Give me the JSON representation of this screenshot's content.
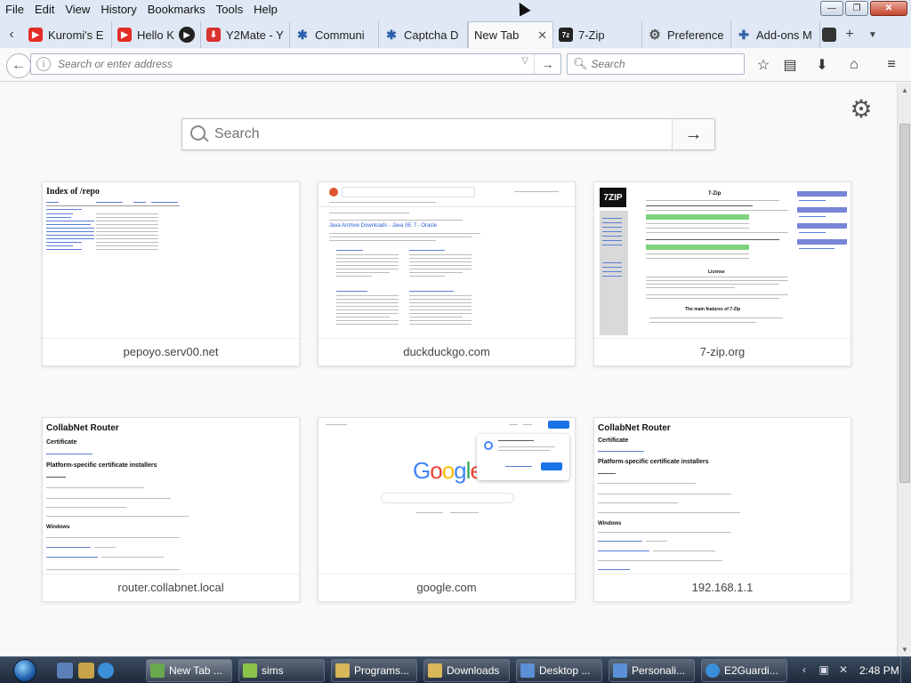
{
  "menu": [
    "File",
    "Edit",
    "View",
    "History",
    "Bookmarks",
    "Tools",
    "Help"
  ],
  "window_controls": {
    "minimize": "—",
    "restore": "❐",
    "close": "✕"
  },
  "tabs": [
    {
      "label": "Kuromi's E",
      "icon": "youtube-icon"
    },
    {
      "label": "Hello K",
      "icon": "youtube-icon"
    },
    {
      "label": "Y2Mate - Y",
      "icon": "y2mate-icon"
    },
    {
      "label": "Communi",
      "icon": "github-icon"
    },
    {
      "label": "Captcha D",
      "icon": "github-icon"
    },
    {
      "label": "New Tab",
      "icon": "",
      "active": true
    },
    {
      "label": "7-Zip",
      "icon": "7zip-icon"
    },
    {
      "label": "Preference",
      "icon": "gear-icon"
    },
    {
      "label": "Add-ons M",
      "icon": "puzzle-icon"
    }
  ],
  "nav": {
    "url_placeholder": "Search or enter address",
    "search_placeholder": "Search"
  },
  "page": {
    "search_placeholder": "Search",
    "tiles": [
      {
        "title": "pepoyo.serv00.net",
        "thumb_heading": "Index of /repo"
      },
      {
        "title": "duckduckgo.com",
        "thumb_heading": "Java Archive Downloads - Java SE 7 - Oracle"
      },
      {
        "title": "7-zip.org",
        "thumb_heading": "7-Zip"
      },
      {
        "title": "router.collabnet.local",
        "thumb_heading": "CollabNet Router"
      },
      {
        "title": "google.com",
        "thumb_heading": "Google"
      },
      {
        "title": "192.168.1.1",
        "thumb_heading": "CollabNet Router"
      }
    ],
    "collab_thumb": {
      "certificate": "Certificate",
      "installers": "Platform-specific certificate installers",
      "windows": "Windows"
    },
    "sevenzip_thumb": {
      "logo": "7ZIP",
      "heading": "7-Zip",
      "section": "License",
      "features": "The main features of 7-Zip"
    }
  },
  "taskbar": {
    "buttons": [
      {
        "label": "New Tab ..."
      },
      {
        "label": "sims"
      },
      {
        "label": "Programs..."
      },
      {
        "label": "Downloads"
      },
      {
        "label": "Desktop ..."
      },
      {
        "label": "Personali..."
      },
      {
        "label": "E2Guardi..."
      }
    ],
    "time": "2:48 PM"
  }
}
